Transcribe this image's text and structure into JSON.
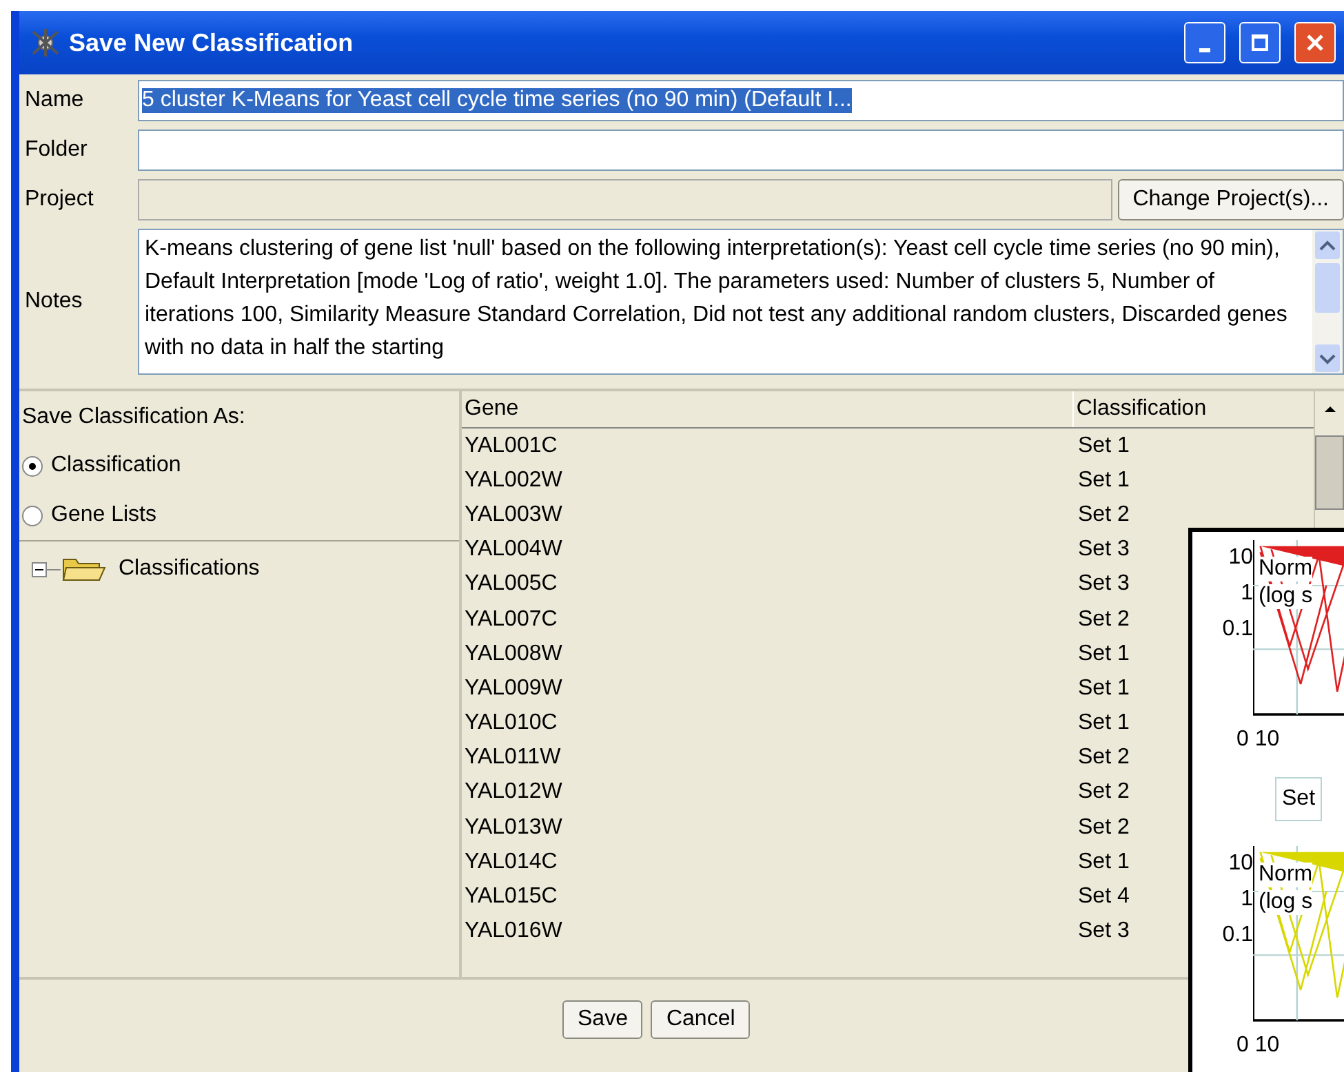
{
  "window": {
    "title": "Save New Classification"
  },
  "form": {
    "name": {
      "label": "Name",
      "value": "5 cluster K-Means for Yeast cell cycle time series (no 90 min) (Default I..."
    },
    "folder": {
      "label": "Folder"
    },
    "project": {
      "label": "Project",
      "button": "Change Project(s)..."
    },
    "notes": {
      "label": "Notes",
      "value": "K-means clustering of gene list 'null' based on the following interpretation(s): Yeast cell cycle time series (no 90 min), Default Interpretation [mode 'Log of ratio', weight 1.0]. The parameters used: Number of clusters 5, Number of iterations 100, Similarity Measure Standard Correlation, Did not test any additional random clusters, Discarded genes with no data in half the starting"
    }
  },
  "save_as": {
    "label": "Save Classification As:",
    "options": [
      {
        "label": "Classification",
        "selected": true
      },
      {
        "label": "Gene Lists",
        "selected": false
      }
    ]
  },
  "tree": [
    {
      "label": "Classifications",
      "expanded": true
    }
  ],
  "table": {
    "columns": [
      "Gene",
      "Classification"
    ],
    "rows": [
      [
        "YAL001C",
        "Set 1"
      ],
      [
        "YAL002W",
        "Set 1"
      ],
      [
        "YAL003W",
        "Set 2"
      ],
      [
        "YAL004W",
        "Set 3"
      ],
      [
        "YAL005C",
        "Set 3"
      ],
      [
        "YAL007C",
        "Set 2"
      ],
      [
        "YAL008W",
        "Set 1"
      ],
      [
        "YAL009W",
        "Set 1"
      ],
      [
        "YAL010C",
        "Set 1"
      ],
      [
        "YAL011W",
        "Set 2"
      ],
      [
        "YAL012W",
        "Set 2"
      ],
      [
        "YAL013W",
        "Set 2"
      ],
      [
        "YAL014C",
        "Set 1"
      ],
      [
        "YAL015C",
        "Set 4"
      ],
      [
        "YAL016W",
        "Set 3"
      ]
    ]
  },
  "buttons": [
    "Save",
    "Cancel"
  ],
  "background_window": {
    "plots": [
      {
        "color": "#e02020",
        "y_ticks": [
          "10",
          "1",
          "0.1"
        ],
        "title": "Norm",
        "subtitle": "(log s",
        "x_ticks": "0 10"
      },
      {
        "color": "#d8d800",
        "y_ticks": [
          "10",
          "1",
          "0.1"
        ],
        "title": "Norm",
        "subtitle": "(log s",
        "x_ticks": "0 10"
      }
    ],
    "set_label": "Set"
  }
}
